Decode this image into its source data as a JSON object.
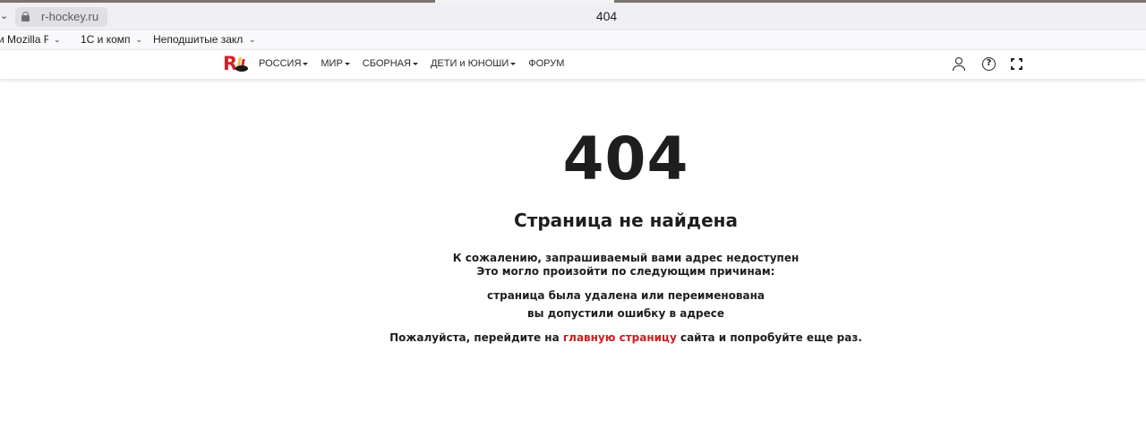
{
  "browser": {
    "url": "r-hockey.ru",
    "tab_title": "404",
    "bookmarks": [
      {
        "label": "и Mozilla Firefox"
      },
      {
        "label": "1С и комп"
      },
      {
        "label": "Неподшитые закладки"
      }
    ]
  },
  "site": {
    "logo_letter": "R",
    "nav": [
      {
        "label": "РОССИЯ"
      },
      {
        "label": "МИР"
      },
      {
        "label": "СБОРНАЯ"
      },
      {
        "label": "ДЕТИ и ЮНОШИ"
      },
      {
        "label": "ФОРУМ"
      }
    ],
    "help_glyph": "?"
  },
  "error": {
    "code": "404",
    "title": "Страница не найдена",
    "line1": "К сожалению, запрашиваемый вами адрес недоступен",
    "line2": "Это могло произойти по следующим причинам:",
    "reasons": [
      "страница была удалена или переименована",
      "вы допустили ошибку в адресе"
    ],
    "final_prefix": "Пожалуйста, перейдите на ",
    "final_link": "главную страницу",
    "final_suffix": " сайта и попробуйте еще раз."
  },
  "colors": {
    "accent": "#c8201f",
    "logo_red": "#d32027"
  }
}
